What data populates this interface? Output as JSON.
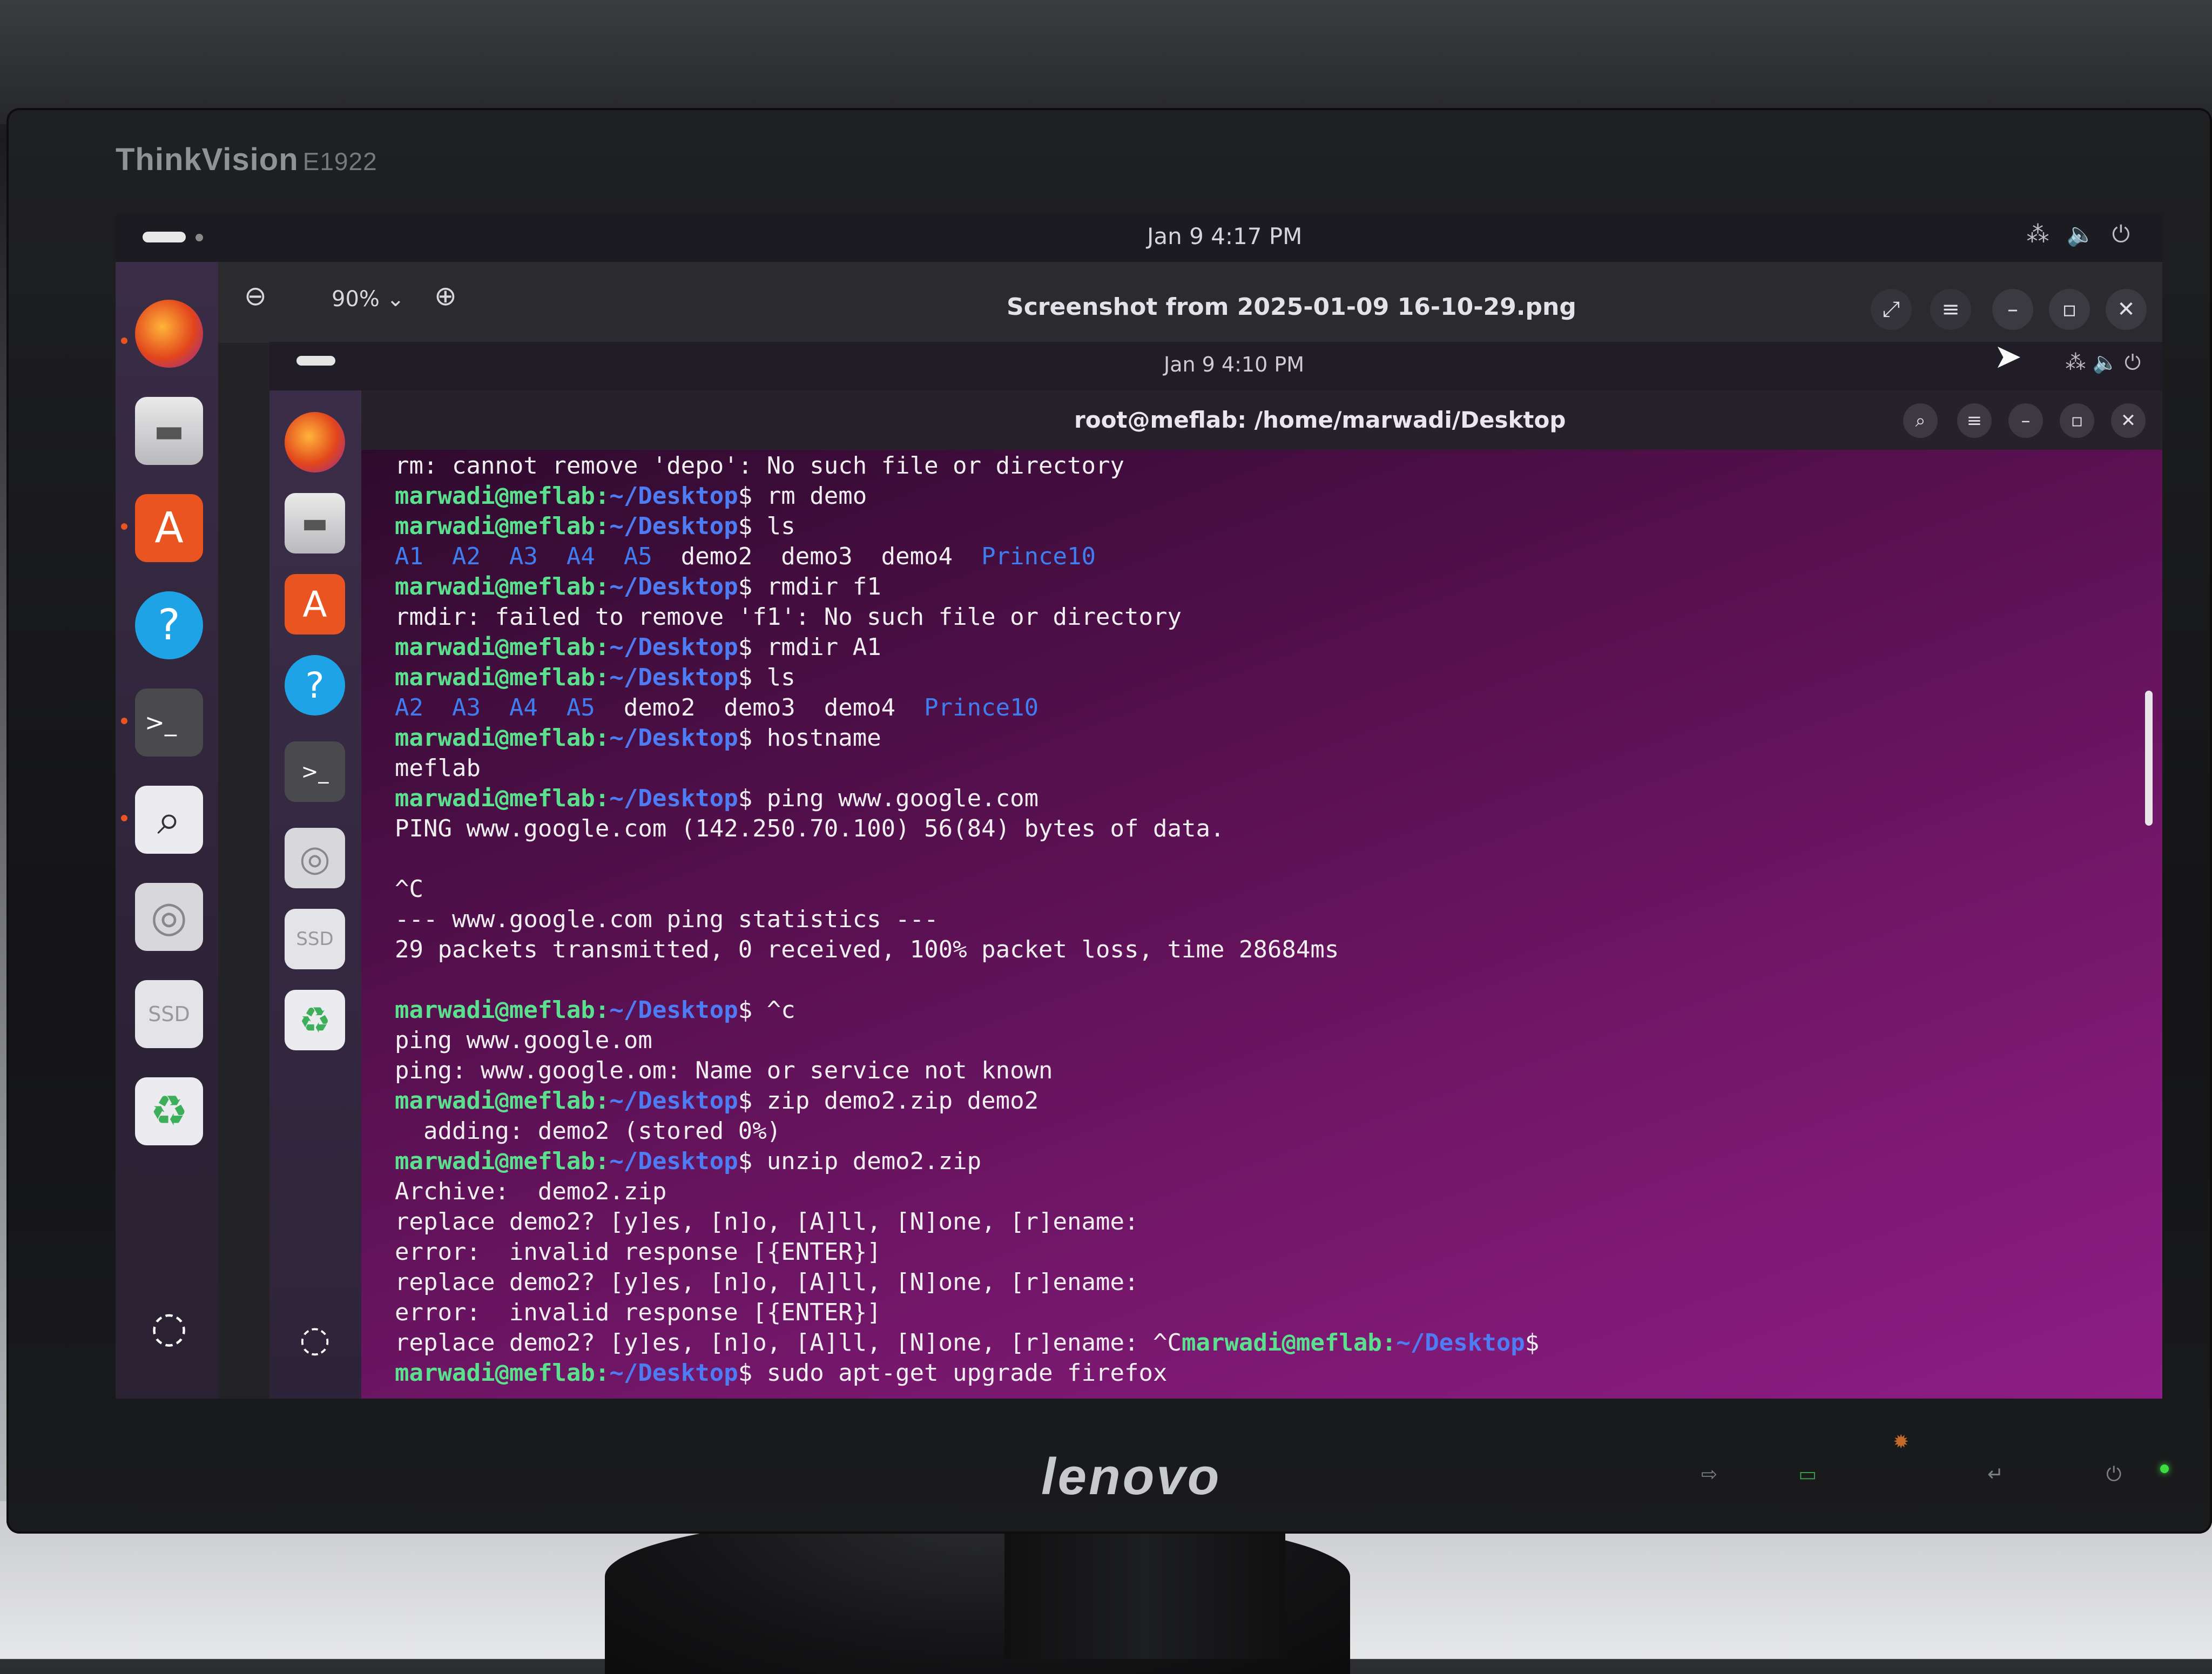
{
  "monitor": {
    "model_brand": "ThinkVision",
    "model_number": "E1922",
    "maker_logo": "lenovo",
    "hw_buttons": [
      "input-icon",
      "eco-icon",
      "brightness-icon",
      "enter-icon",
      "power-icon"
    ]
  },
  "topbar": {
    "clock": "Jan 9   4:17 PM",
    "tray_icons": [
      "network-icon",
      "volume-icon",
      "power-icon"
    ]
  },
  "dock": {
    "apps": [
      "firefox-icon",
      "files-icon",
      "app-center-icon",
      "help-icon",
      "terminal-icon",
      "image-viewer-icon",
      "disc-icon",
      "ssd-drive-icon",
      "trash-icon"
    ],
    "ssd_label": "SSD",
    "show_apps_icon": "ubuntu-logo-icon"
  },
  "viewer": {
    "zoom": "90%",
    "title": "Screenshot from 2025-01-09 16-10-29.png",
    "buttons": [
      "zoom-out-icon",
      "zoom-in-icon",
      "fullscreen-icon",
      "menu-icon",
      "minimize-icon",
      "maximize-icon",
      "close-icon"
    ]
  },
  "shot": {
    "clock": "Jan 9   4:10 PM",
    "terminal_title": "root@meflab: /home/marwadi/Desktop"
  },
  "terminal": {
    "prompt_user": "marwadi@meflab:",
    "prompt_path": "~/Desktop",
    "lines": [
      {
        "t": "out",
        "text": "rm: cannot remove 'depo': No such file or directory"
      },
      {
        "t": "cmd",
        "cmd": "rm demo"
      },
      {
        "t": "cmd",
        "cmd": "ls"
      },
      {
        "t": "ls",
        "blue": "A1  A2  A3  A4  A5",
        "plain": "  demo2  demo3  demo4  ",
        "blue2": "Prince10"
      },
      {
        "t": "cmd",
        "cmd": "rmdir f1"
      },
      {
        "t": "out",
        "text": "rmdir: failed to remove 'f1': No such file or directory"
      },
      {
        "t": "cmd",
        "cmd": "rmdir A1"
      },
      {
        "t": "cmd",
        "cmd": "ls"
      },
      {
        "t": "ls",
        "blue": "A2  A3  A4  A5",
        "plain": "  demo2  demo3  demo4  ",
        "blue2": "Prince10"
      },
      {
        "t": "cmd",
        "cmd": "hostname"
      },
      {
        "t": "out",
        "text": "meflab"
      },
      {
        "t": "cmd",
        "cmd": "ping www.google.com"
      },
      {
        "t": "out",
        "text": "PING www.google.com (142.250.70.100) 56(84) bytes of data."
      },
      {
        "t": "out",
        "text": ""
      },
      {
        "t": "out",
        "text": "^C"
      },
      {
        "t": "out",
        "text": "--- www.google.com ping statistics ---"
      },
      {
        "t": "out",
        "text": "29 packets transmitted, 0 received, 100% packet loss, time 28684ms"
      },
      {
        "t": "out",
        "text": ""
      },
      {
        "t": "cmd",
        "cmd": "^c"
      },
      {
        "t": "out",
        "text": "ping www.google.om"
      },
      {
        "t": "out",
        "text": "ping: www.google.om: Name or service not known"
      },
      {
        "t": "cmd",
        "cmd": "zip demo2.zip demo2"
      },
      {
        "t": "out",
        "text": "  adding: demo2 (stored 0%)"
      },
      {
        "t": "cmd",
        "cmd": "unzip demo2.zip"
      },
      {
        "t": "out",
        "text": "Archive:  demo2.zip"
      },
      {
        "t": "out",
        "text": "replace demo2? [y]es, [n]o, [A]ll, [N]one, [r]ename:"
      },
      {
        "t": "out",
        "text": "error:  invalid response [{ENTER}]"
      },
      {
        "t": "out",
        "text": "replace demo2? [y]es, [n]o, [A]ll, [N]one, [r]ename:"
      },
      {
        "t": "out",
        "text": "error:  invalid response [{ENTER}]"
      },
      {
        "t": "mixed",
        "text": "replace demo2? [y]es, [n]o, [A]ll, [N]one, [r]ename: ^C"
      },
      {
        "t": "cmd",
        "cmd": "sudo apt-get upgrade firefox"
      }
    ]
  },
  "colors": {
    "prompt_user": "#5be08d",
    "prompt_path": "#4e7cf5",
    "terminal_bg": "#7a1870",
    "accent": "#e95420"
  }
}
